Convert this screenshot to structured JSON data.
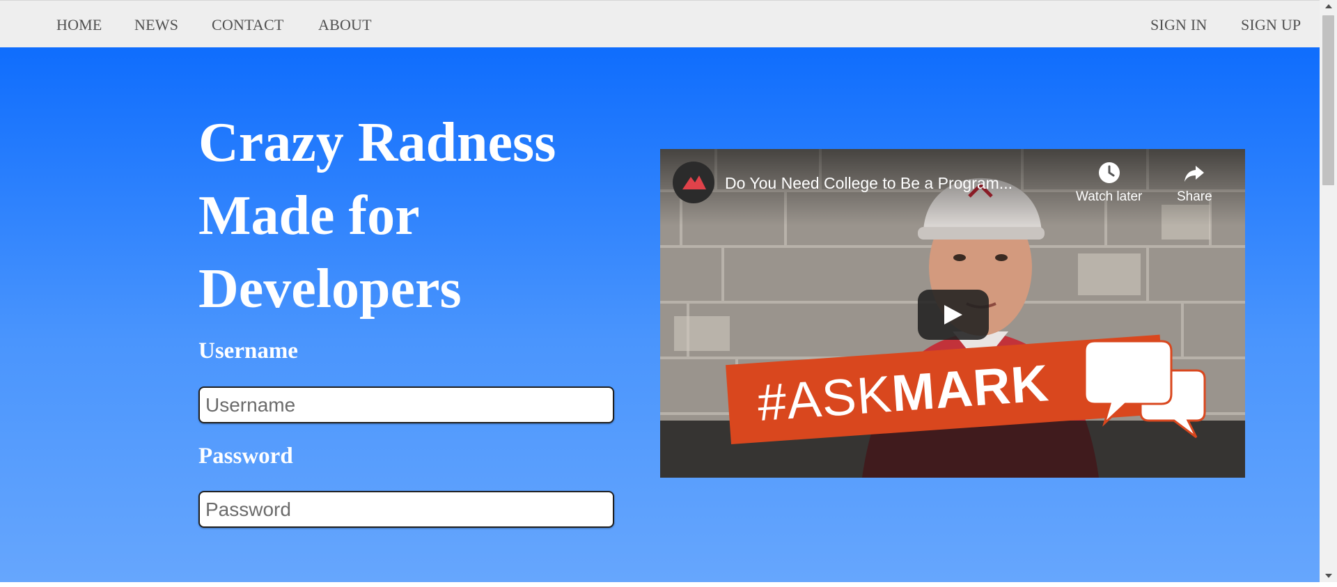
{
  "nav": {
    "left_links": [
      "HOME",
      "NEWS",
      "CONTACT",
      "ABOUT"
    ],
    "right_links": [
      "SIGN IN",
      "SIGN UP"
    ]
  },
  "hero": {
    "title_lines": [
      "Crazy Radness",
      "Made for",
      "Developers"
    ],
    "username": {
      "label": "Username",
      "placeholder": "Username",
      "value": ""
    },
    "password": {
      "label": "Password",
      "placeholder": "Password",
      "value": ""
    }
  },
  "video": {
    "title": "Do You Need College to Be a Program...",
    "watch_later_label": "Watch later",
    "share_label": "Share",
    "banner_hash": "#ASK",
    "banner_bold": "MARK",
    "icons": [
      "channel-logo-icon",
      "clock-icon",
      "share-arrow-icon",
      "play-icon",
      "speech-bubbles-icon"
    ]
  },
  "colors": {
    "hero_top": "#0f6dfd",
    "hero_bottom": "#66a6fd",
    "navbar_bg": "#eeeeee",
    "nav_text": "#4f4f4f",
    "banner": "#d9471e"
  }
}
